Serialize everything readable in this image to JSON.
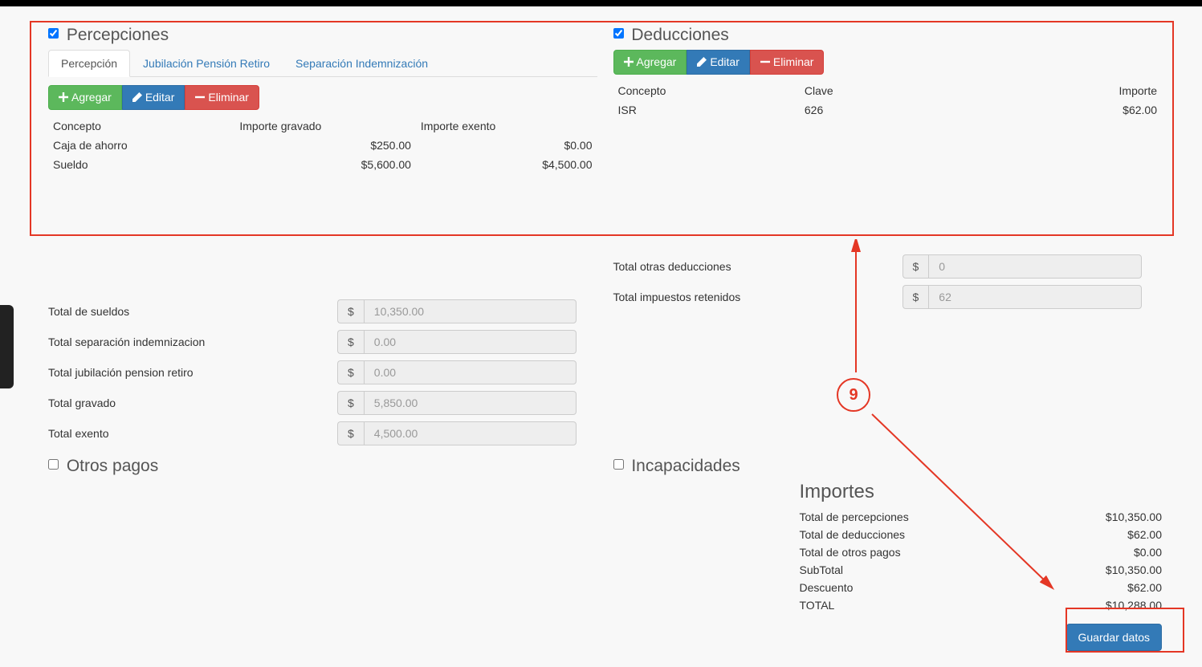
{
  "percepciones": {
    "title": "Percepciones",
    "checked": true,
    "tabs": [
      "Percepción",
      "Jubilación Pensión Retiro",
      "Separación Indemnización"
    ],
    "buttons": {
      "add": "Agregar",
      "edit": "Editar",
      "del": "Eliminar"
    },
    "cols": {
      "concepto": "Concepto",
      "gravado": "Importe gravado",
      "exento": "Importe exento"
    },
    "rows": [
      {
        "concepto": "Caja de ahorro",
        "gravado": "$250.00",
        "exento": "$0.00"
      },
      {
        "concepto": "Sueldo",
        "gravado": "$5,600.00",
        "exento": "$4,500.00"
      }
    ]
  },
  "deducciones": {
    "title": "Deducciones",
    "checked": true,
    "buttons": {
      "add": "Agregar",
      "edit": "Editar",
      "del": "Eliminar"
    },
    "cols": {
      "concepto": "Concepto",
      "clave": "Clave",
      "importe": "Importe"
    },
    "rows": [
      {
        "concepto": "ISR",
        "clave": "626",
        "importe": "$62.00"
      }
    ],
    "totals": {
      "otras_label": "Total otras deducciones",
      "otras_value": "0",
      "retenidos_label": "Total impuestos retenidos",
      "retenidos_value": "62"
    }
  },
  "percep_totals": {
    "currency": "$",
    "sueldos_label": "Total de sueldos",
    "sueldos_value": "10,350.00",
    "separacion_label": "Total separación indemnizacion",
    "separacion_value": "0.00",
    "jubilacion_label": "Total jubilación pension retiro",
    "jubilacion_value": "0.00",
    "gravado_label": "Total gravado",
    "gravado_value": "5,850.00",
    "exento_label": "Total exento",
    "exento_value": "4,500.00"
  },
  "otros_pagos": {
    "title": "Otros pagos",
    "checked": false
  },
  "incapacidades": {
    "title": "Incapacidades",
    "checked": false
  },
  "importes": {
    "title": "Importes",
    "lines": [
      {
        "label": "Total de percepciones",
        "value": "$10,350.00"
      },
      {
        "label": "Total de deducciones",
        "value": "$62.00"
      },
      {
        "label": "Total de otros pagos",
        "value": "$0.00"
      },
      {
        "label": "SubTotal",
        "value": "$10,350.00"
      },
      {
        "label": "Descuento",
        "value": "$62.00"
      },
      {
        "label": "TOTAL",
        "value": "$10,288.00"
      }
    ]
  },
  "save_label": "Guardar datos",
  "annotation": {
    "step": "9"
  }
}
